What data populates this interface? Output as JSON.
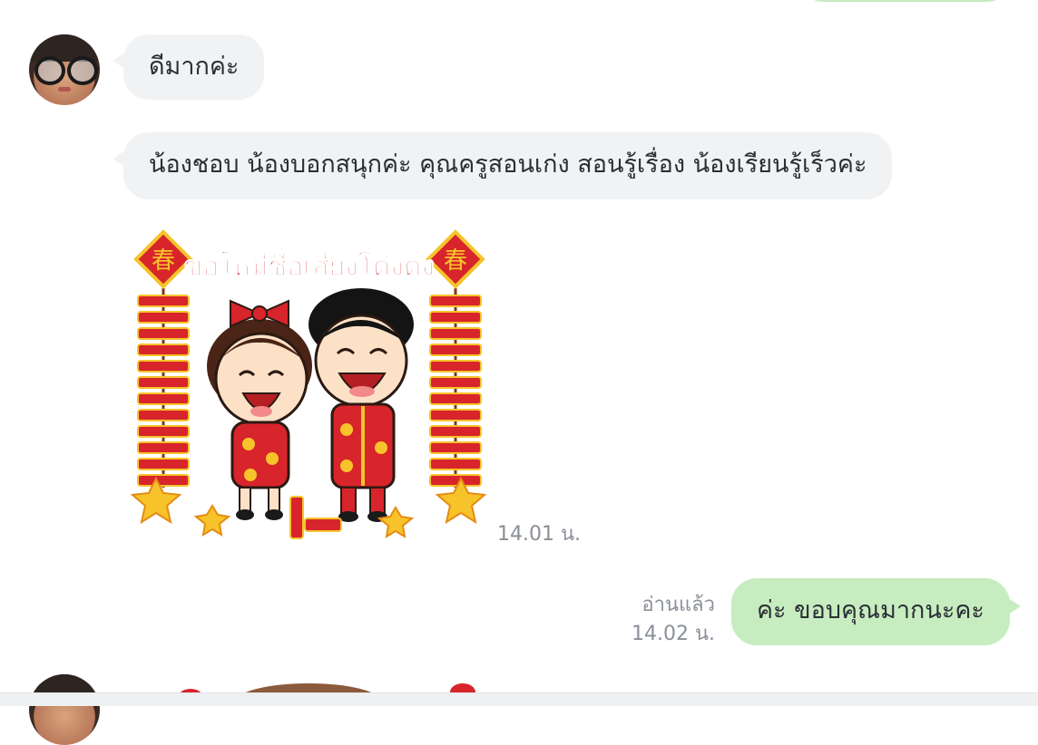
{
  "messages": [
    {
      "id": "m1",
      "direction": "incoming",
      "text": "ดีมากค่ะ"
    },
    {
      "id": "m2",
      "direction": "incoming",
      "text": "น้องชอบ น้องบอกสนุกค่ะ คุณครูสอนเก่ง สอนรู้เรื่อง น้องเรียนรู้เร็วค่ะ"
    },
    {
      "id": "m3",
      "direction": "incoming",
      "type": "sticker",
      "sticker_text": "ขอให้มีชื่อเสียงโด่งดัง",
      "sticker_badge": "春",
      "time": "14.01 น."
    },
    {
      "id": "m4",
      "direction": "outgoing",
      "text": "ค่ะ ขอบคุณมากนะคะ",
      "read_label": "อ่านแล้ว",
      "time": "14.02 น."
    }
  ],
  "colors": {
    "incoming_bubble": "#f1f2f4",
    "outgoing_bubble": "#c6ecbf",
    "meta_text": "#8a8f98",
    "sticker_red": "#d8242b",
    "sticker_gold": "#f6c42a"
  },
  "icons": {
    "avatar": "user-avatar-glasses"
  }
}
